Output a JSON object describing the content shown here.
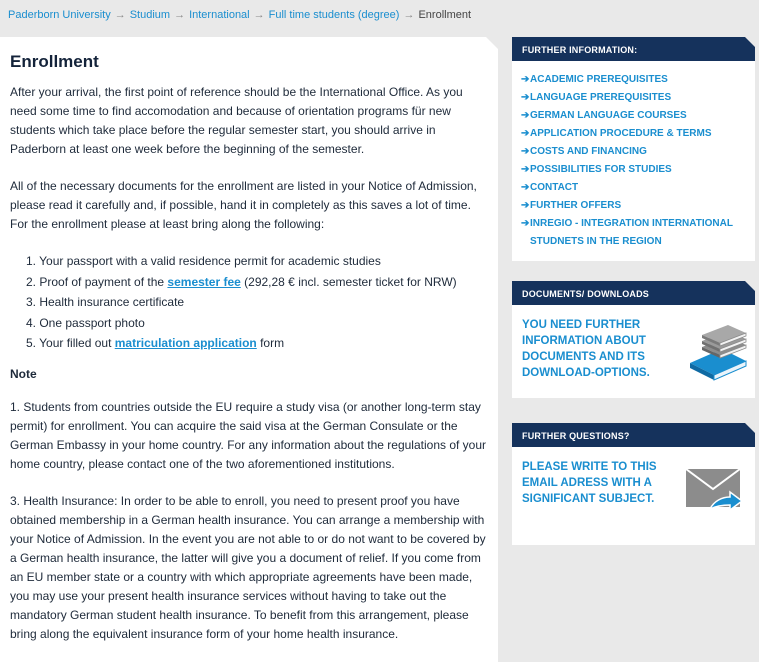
{
  "breadcrumb": {
    "items": [
      "Paderborn University",
      "Studium",
      "International",
      "Full time students (degree)"
    ],
    "current": "Enrollment",
    "separator": "→"
  },
  "main": {
    "title": "Enrollment",
    "para1": "After your arrival, the first point of reference should be the International Office. As you need some time to find accomodation and because of orientation programs für new students which take place before the regular semester start, you should arrive in Paderborn at least one week before the beginning of the semester.",
    "para2": "All of the necessary documents for the enrollment are listed in your Notice of Admission, please read it carefully and, if possible, hand it in completely as this saves a lot of time. For the enrollment please at least bring along the following:",
    "list": {
      "item1": "1. Your passport with a valid residence permit for academic studies",
      "item2_pre": "2. Proof of payment of the ",
      "item2_link": "semester fee",
      "item2_post": " (292,28 € incl. semester ticket for NRW)",
      "item3": "3. Health insurance certificate",
      "item4": "4. One passport photo",
      "item5_pre": "5. Your filled out ",
      "item5_link": "matriculation application",
      "item5_post": " form"
    },
    "note_heading": "Note",
    "note1": "1.  Students from countries outside the EU require a study visa (or another long-term stay permit) for enrollment. You can acquire the said visa at the German Consulate or the German Embassy in your home country. For any information about the regulations of your home country, please contact one of the two aforementioned institutions.",
    "note3": "3.  Health Insurance: In order to be able to enroll, you need to present proof you have obtained membership in a German health insurance. You can arrange a membership with your Notice of Admission. In the event you are not able to or do not want to be covered by a German health insurance, the latter will give you a document of relief. If you come from an EU member state or a country with which appropriate agreements have been made, you may use your present health insurance services without having to take out the mandatory German student health insurance. To benefit from this arrangement, please bring along the equivalent insurance form of your home health insurance."
  },
  "further_info": {
    "header": "FURTHER INFORMATION:",
    "arrow": "➔",
    "items": [
      "ACADEMIC PREREQUISITES",
      "LANGUAGE PREREQUISITES",
      "GERMAN LANGUAGE COURSES",
      "APPLICATION PROCEDURE & TERMS",
      "COSTS AND FINANCING",
      "POSSIBILITIES FOR STUDIES",
      "CONTACT",
      "FURTHER OFFERS",
      "INREGIO - INTEGRATION INTERNATIONAL STUDNETS IN THE REGION"
    ]
  },
  "downloads": {
    "header": "DOCUMENTS/ DOWNLOADS",
    "text": "YOU NEED FURTHER INFORMATION ABOUT DOCUMENTS AND ITS DOWNLOAD-OPTIONS.",
    "icon": "books-icon"
  },
  "questions": {
    "header": "FURTHER QUESTIONS?",
    "text": "PLEASE WRITE TO THIS EMAIL ADRESS WITH A SIGNIFICANT SUBJECT.",
    "icon": "mail-forward-icon"
  },
  "colors": {
    "accent": "#1a8ecf",
    "header_bg": "#15325c",
    "page_bg": "#e9e9e9"
  }
}
